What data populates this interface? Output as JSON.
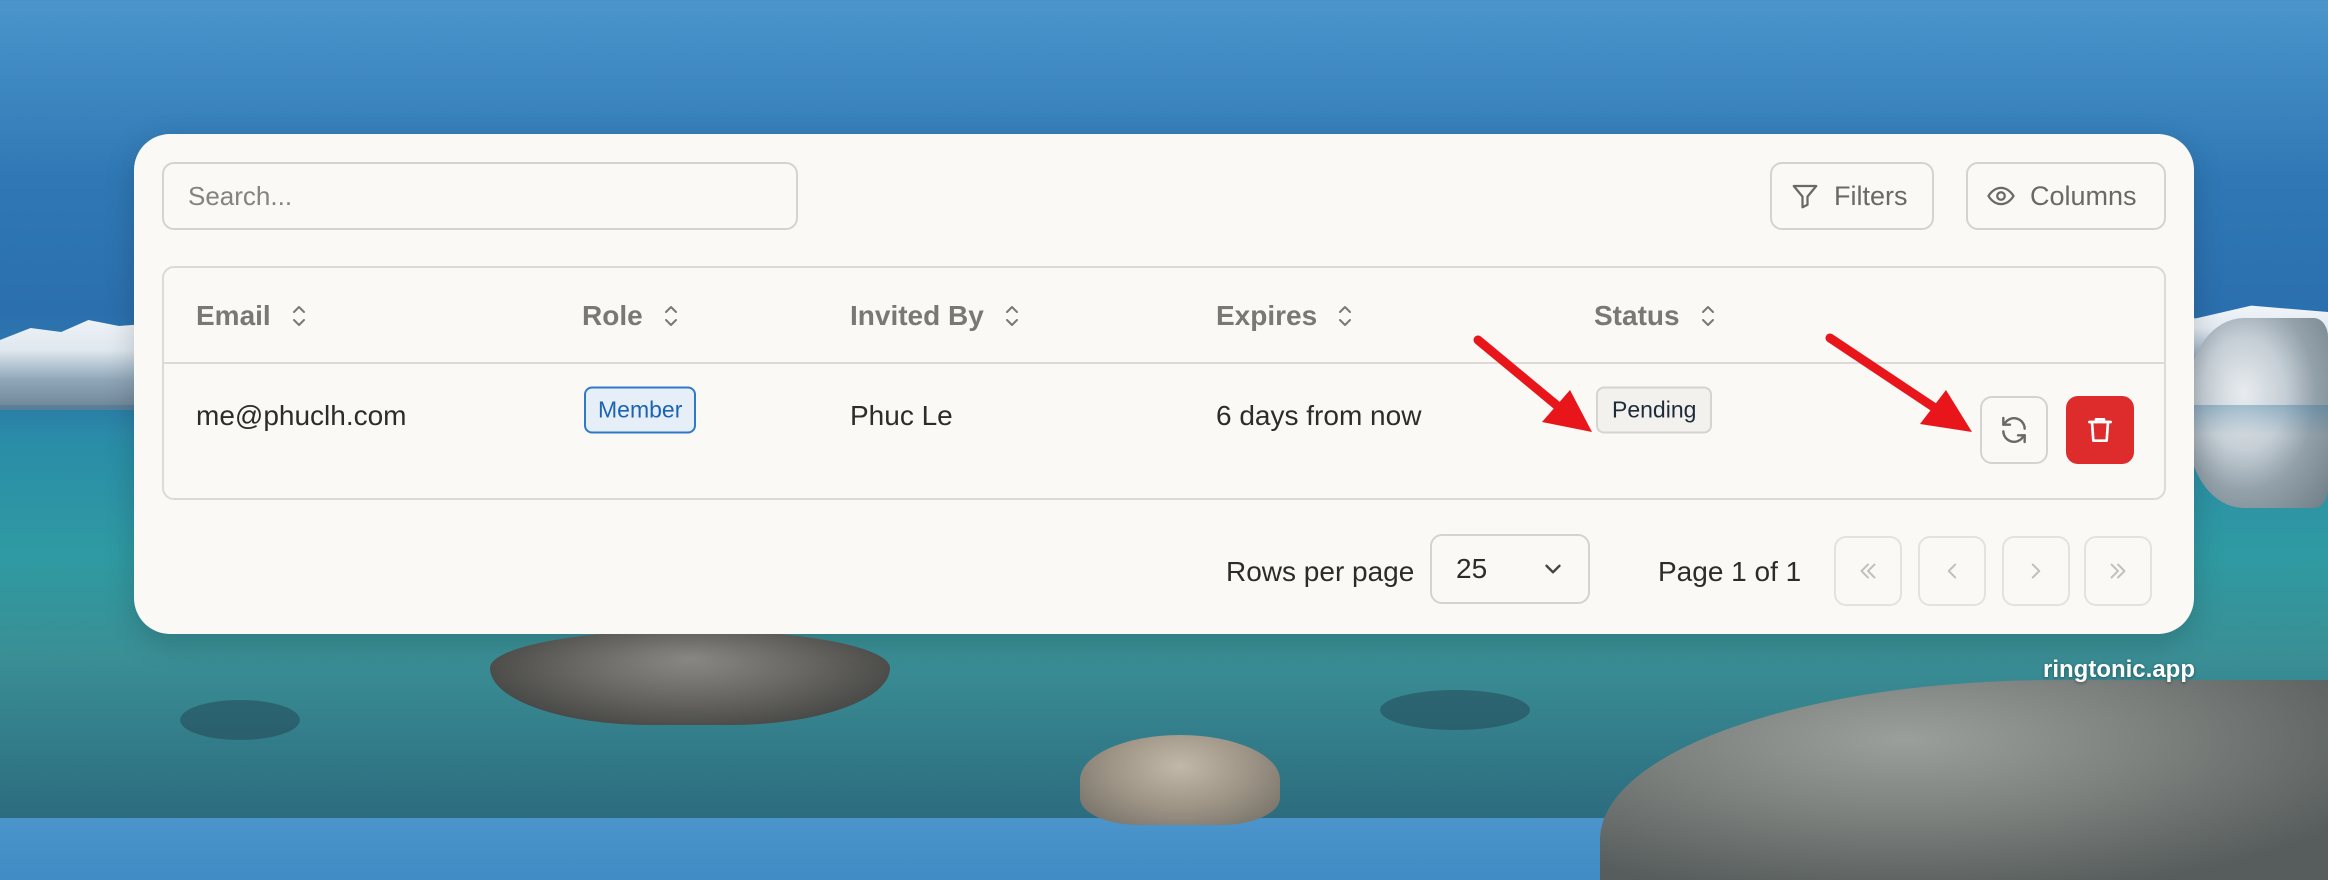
{
  "watermark": "ringtonic.app",
  "toolbar": {
    "search_placeholder": "Search...",
    "filters_label": "Filters",
    "filters_icon": "filter-icon",
    "columns_label": "Columns",
    "columns_icon": "eye-icon"
  },
  "table": {
    "columns": [
      "Email",
      "Role",
      "Invited By",
      "Expires",
      "Status"
    ],
    "rows": [
      {
        "email": "me@phuclh.com",
        "role": "Member",
        "invited_by": "Phuc Le",
        "expires": "6 days from now",
        "status": "Pending",
        "actions": [
          "refresh-icon",
          "trash-icon"
        ]
      }
    ]
  },
  "pagination": {
    "rows_per_page_label": "Rows per page",
    "rows_per_page_value": "25",
    "page_info": "Page 1 of 1",
    "buttons": [
      "first-page-icon",
      "previous-page-icon",
      "next-page-icon",
      "last-page-icon"
    ]
  },
  "colors": {
    "panel_bg": "#faf9f6",
    "member_badge": "#2f79c8",
    "delete_button": "#de2b2b",
    "annotation_arrow": "#e8161b"
  }
}
